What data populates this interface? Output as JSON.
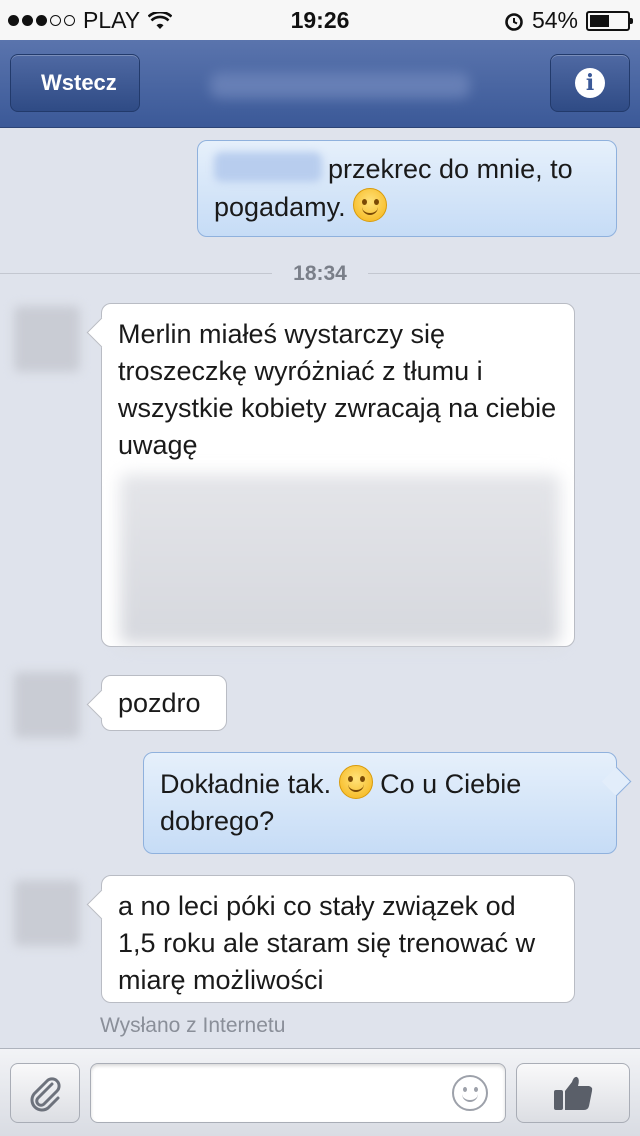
{
  "status_bar": {
    "carrier": "PLAY",
    "time": "19:26",
    "battery": "54%",
    "battery_level": 0.54,
    "signal_bars_filled": 3,
    "signal_bars_total": 5
  },
  "nav": {
    "back_label": "Wstecz",
    "info_icon": "i"
  },
  "messages": [
    {
      "direction": "outgoing",
      "text_before_emoji": "przekrec do mnie, to",
      "text_after": "pogadamy.",
      "emoji": "smiling-face"
    },
    {
      "direction": "incoming",
      "text": "Merlin miałeś wystarczy się troszeczkę wyróżniać z tłumu i wszystkie kobiety zwracają na ciebie uwagę"
    },
    {
      "direction": "incoming",
      "text": "pozdro"
    },
    {
      "direction": "outgoing",
      "text_before_emoji": "Dokładnie tak.",
      "text_after_emoji": "Co u Ciebie dobrego?",
      "emoji": "smiling-face"
    },
    {
      "direction": "incoming",
      "text": "a no leci póki co stały związek od 1,5 roku ale staram się trenować w miarę możliwości"
    }
  ],
  "timestamp": "18:34",
  "sent_note": "Wysłano z Internetu",
  "composer": {
    "placeholder": "",
    "attach_icon": "paperclip-icon",
    "emoji_icon": "smiley-icon",
    "like_icon": "thumbs-up-icon"
  },
  "colors": {
    "nav_bar": "#3b5998",
    "outgoing_bubble": "#c6dcf6",
    "background": "#dfe3ec"
  }
}
